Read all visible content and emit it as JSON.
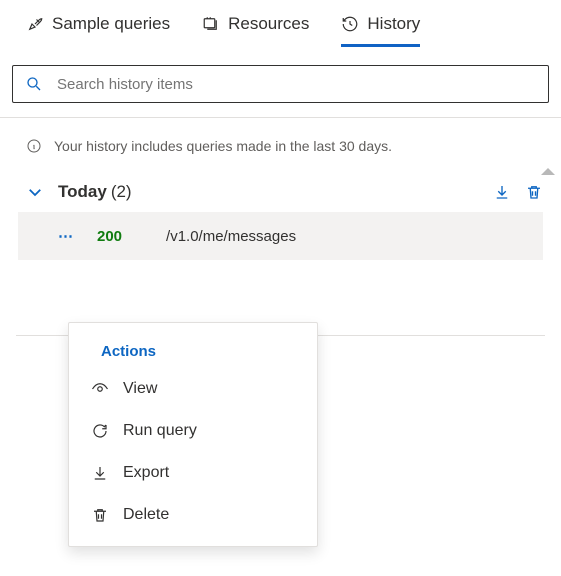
{
  "tabs": {
    "sample_queries": "Sample queries",
    "resources": "Resources",
    "history": "History"
  },
  "search": {
    "placeholder": "Search history items"
  },
  "info_text": "Your history includes queries made in the last 30 days.",
  "group": {
    "title": "Today",
    "count": "(2)"
  },
  "item": {
    "status": "200",
    "path": "/v1.0/me/messages"
  },
  "menu": {
    "title": "Actions",
    "view": "View",
    "run": "Run query",
    "export": "Export",
    "delete": "Delete"
  }
}
